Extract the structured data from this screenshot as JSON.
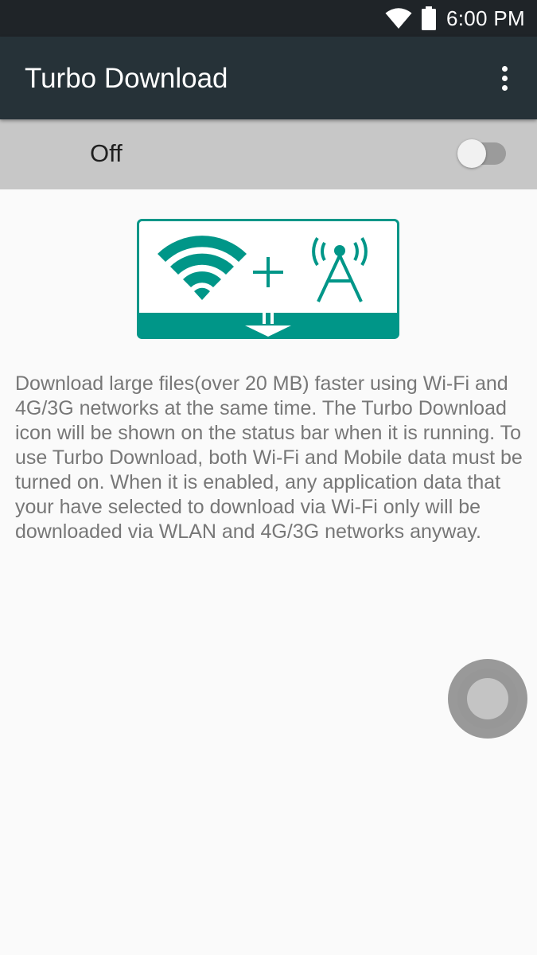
{
  "status_bar": {
    "time": "6:00 PM",
    "wifi_icon": "wifi-icon",
    "battery_icon": "battery-icon"
  },
  "app_bar": {
    "title": "Turbo Download",
    "overflow_icon": "more-vert-icon"
  },
  "switch": {
    "label": "Off",
    "state": false
  },
  "illustration": {
    "icons": [
      "wifi-icon",
      "plus-icon",
      "cell-tower-icon",
      "download-arrow-icon"
    ],
    "accent_color": "#009688"
  },
  "description": "Download large files(over 20 MB) faster using Wi-Fi and 4G/3G networks at the same time. The Turbo Download icon will be shown on the status bar when it is running. To use Turbo Download, both Wi-Fi and Mobile data must be turned on. When it is enabled, any application data that your have selected to download via Wi-Fi only will be downloaded via WLAN and 4G/3G networks anyway.",
  "floating_button": {
    "icon": "assistive-touch-icon"
  },
  "colors": {
    "status_bar": "#1f2428",
    "app_bar": "#263238",
    "switch_row": "#c7c7c7",
    "background": "#fafafa",
    "accent": "#009688"
  }
}
